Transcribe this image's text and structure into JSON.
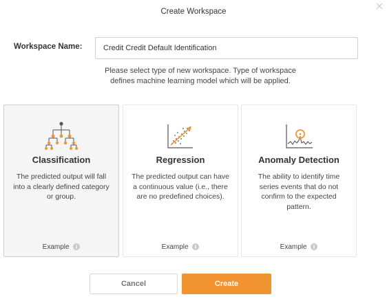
{
  "dialog": {
    "title": "Create Workspace"
  },
  "form": {
    "name_label": "Workspace Name:",
    "name_value": "Credit Credit Default Identification"
  },
  "instructions": {
    "line1": "Please select type of new workspace. Type of workspace",
    "line2": "defines machine learning model which will be applied."
  },
  "cards": [
    {
      "title": "Classification",
      "desc_lines": [
        "The predicted output will fall",
        "into a clearly defined category",
        "or group."
      ],
      "example": "Example",
      "icon": "tree-diagram-icon",
      "selected": true
    },
    {
      "title": "Regression",
      "desc_lines": [
        "The predicted output can have",
        "a continuous value (i.e., there",
        "are no predefined choices)."
      ],
      "example": "Example",
      "icon": "scatter-trend-icon",
      "selected": false
    },
    {
      "title": "Anomaly Detection",
      "desc_lines": [
        "The ability to identify time",
        "series events that do not",
        "confirm to the expected",
        "pattern."
      ],
      "example": "Example",
      "icon": "anomaly-wave-icon",
      "selected": false
    }
  ],
  "buttons": {
    "cancel": "Cancel",
    "create": "Create"
  },
  "colors": {
    "accent": "#f29432",
    "icon_dark": "#555555",
    "selected_card_bg": "#f5f5f5"
  }
}
